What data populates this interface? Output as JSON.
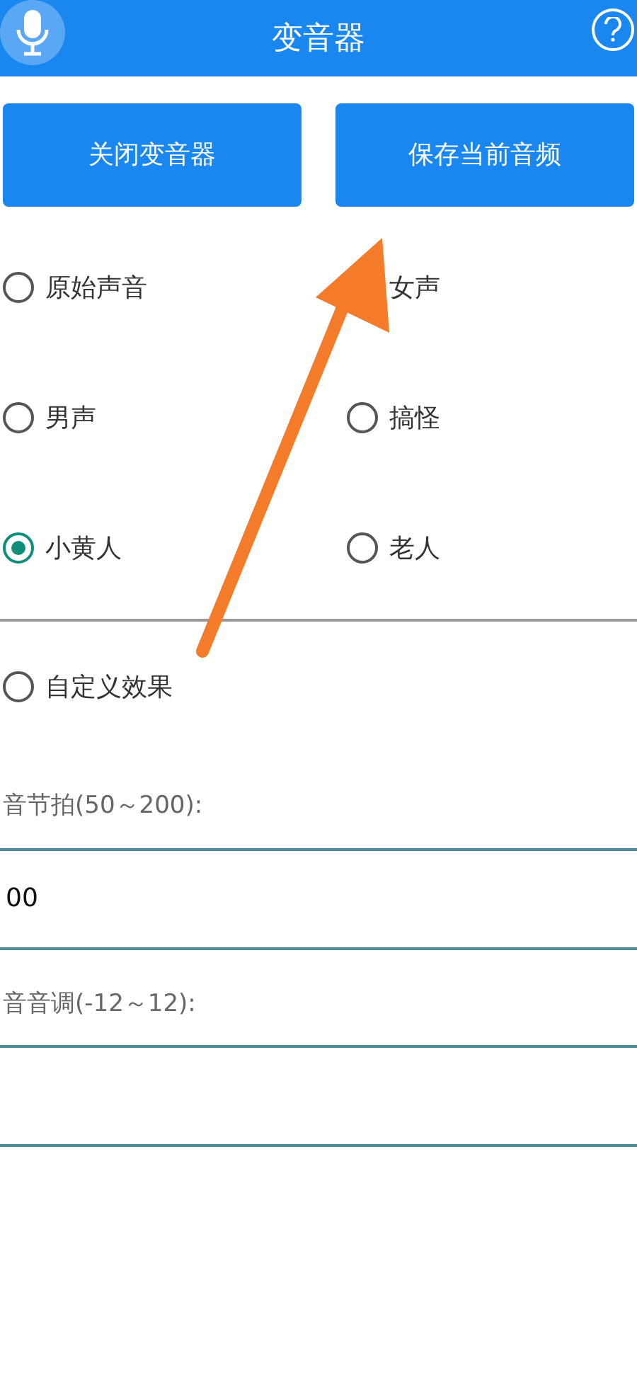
{
  "header": {
    "title": "变音器"
  },
  "buttons": [
    "关闭变音器",
    "保存当前音频"
  ],
  "effects": [
    {
      "label": "原始声音",
      "selected": false
    },
    {
      "label": "女声"
    },
    {
      "label": "男声",
      "selected": false
    },
    {
      "label": "搞怪",
      "selected": false
    },
    {
      "label": "小黄人",
      "selected": true
    },
    {
      "label": "老人",
      "selected": false
    }
  ],
  "custom_effect": {
    "label": "自定义效果",
    "selected": false
  },
  "fields": [
    {
      "label": "音节拍(50～200):",
      "value": "00"
    },
    {
      "label": "音音调(-12～12):"
    }
  ]
}
